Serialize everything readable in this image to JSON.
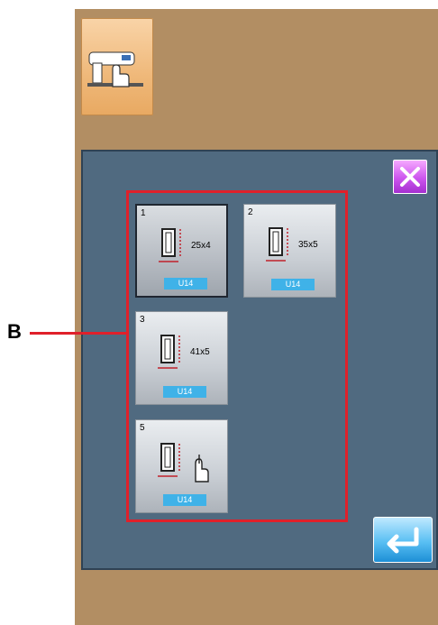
{
  "colors": {
    "device_background": "#b28e63",
    "panel_background": "#506a80",
    "highlight": "#e0202a",
    "badge": "#3fb2e8",
    "close_button": "#cc55ee",
    "enter_button": "#59bff3"
  },
  "toolbar": {
    "mode_icon": "sewing-machine-hand-icon"
  },
  "callout": {
    "label": "B"
  },
  "patterns": [
    {
      "number": "1",
      "size": "25x4",
      "badge": "U14",
      "selected": true,
      "icon": "buttonhole-pattern-icon"
    },
    {
      "number": "2",
      "size": "35x5",
      "badge": "U14",
      "selected": false,
      "icon": "buttonhole-pattern-icon"
    },
    {
      "number": "3",
      "size": "41x5",
      "badge": "U14",
      "selected": false,
      "icon": "buttonhole-pattern-icon"
    },
    {
      "number": "5",
      "size": "",
      "badge": "U14",
      "selected": false,
      "icon": "buttonhole-pattern-icon",
      "pointer_icon": "hand-pointer-icon"
    }
  ],
  "buttons": {
    "close_icon": "close-icon",
    "enter_icon": "enter-icon"
  }
}
